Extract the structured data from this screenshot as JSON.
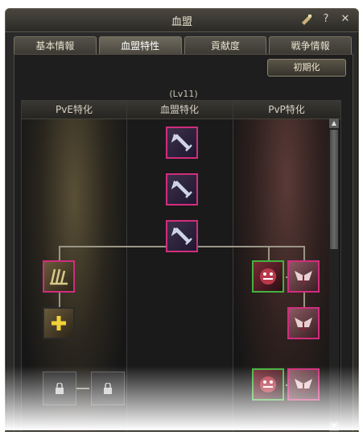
{
  "window": {
    "title": "血盟"
  },
  "title_icons": {
    "quest": "quest-icon",
    "help": "?",
    "close": "✕"
  },
  "tabs": [
    {
      "label": "基本情報"
    },
    {
      "label": "血盟特性"
    },
    {
      "label": "貢献度"
    },
    {
      "label": "戦争情報"
    }
  ],
  "active_tab": 1,
  "reset_label": "初期化",
  "level_label": "(Lv11)",
  "columns": [
    "PvE特化",
    "血盟特化",
    "PvP特化"
  ],
  "colors": {
    "skill_border": "#d12d7d",
    "active_border": "#43b23e"
  }
}
